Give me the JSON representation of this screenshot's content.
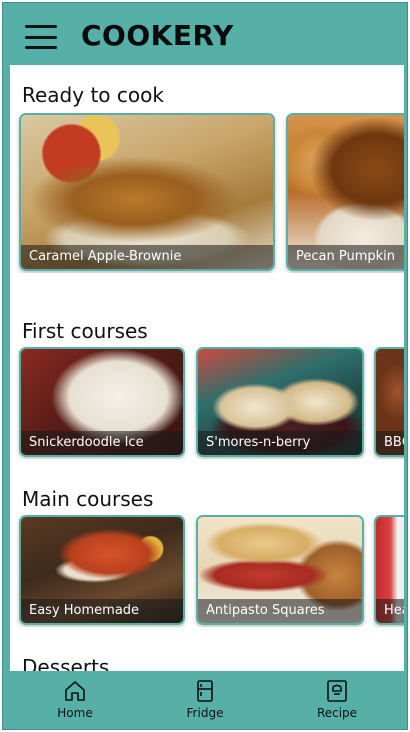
{
  "header": {
    "title": "COOKERY",
    "menu_icon": "hamburger-menu-icon"
  },
  "sections": [
    {
      "title": "Ready to cook",
      "cards": [
        {
          "label": "Caramel Apple-Brownie"
        },
        {
          "label": "Pecan Pumpkin"
        }
      ]
    },
    {
      "title": "First courses",
      "cards": [
        {
          "label": "Snickerdoodle Ice"
        },
        {
          "label": "S'mores-n-berry"
        },
        {
          "label": "BBQ"
        }
      ]
    },
    {
      "title": "Main courses",
      "cards": [
        {
          "label": "Easy Homemade"
        },
        {
          "label": "Antipasto Squares"
        },
        {
          "label": "Hea"
        }
      ]
    },
    {
      "title": "Desserts"
    }
  ],
  "bottom_nav": {
    "items": [
      {
        "label": "Home",
        "icon": "home-icon"
      },
      {
        "label": "Fridge",
        "icon": "fridge-icon"
      },
      {
        "label": "Recipe",
        "icon": "recipe-book-icon"
      }
    ]
  },
  "colors": {
    "accent": "#57b0a8",
    "content_bg": "#ffffff",
    "text": "#111111"
  }
}
